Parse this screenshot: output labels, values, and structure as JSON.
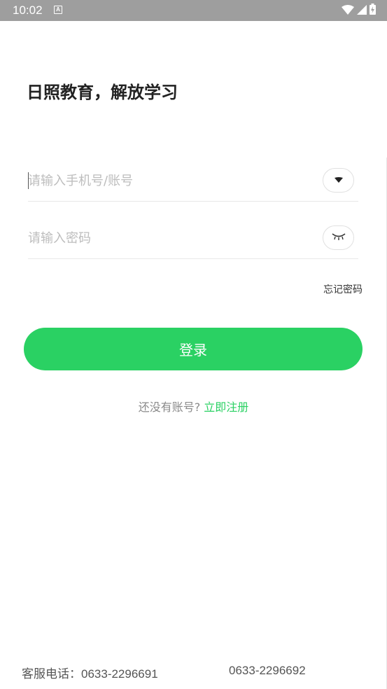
{
  "status_bar": {
    "time": "10:02",
    "notification_icon": "a-letter-icon",
    "icons": [
      "wifi-icon",
      "signal-icon",
      "battery-charging-icon"
    ]
  },
  "app": {
    "title": "日照教育，解放学习"
  },
  "login_form": {
    "phone_placeholder": "请输入手机号/账号",
    "password_placeholder": "请输入密码",
    "phone_toggle_icon": "dropdown-chevron-icon",
    "password_toggle_icon": "eye-closed-icon",
    "forgot_password": "忘记密码",
    "login_button": "登录",
    "register_prompt": "还没有账号?",
    "register_link": "立即注册"
  },
  "footer": {
    "hotline_label": "客服电话：",
    "hotline_1": "0633-2296691",
    "hotline_2": "0633-2296692"
  },
  "colors": {
    "accent": "#2ad163",
    "status_bar": "#9e9e9e",
    "placeholder": "#bdbdbd"
  }
}
